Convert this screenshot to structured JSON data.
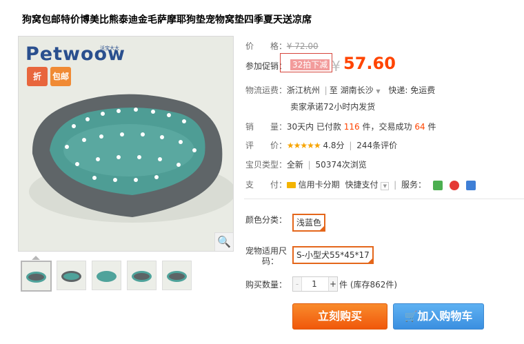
{
  "product": {
    "title": "狗窝包邮特价博美比熊泰迪金毛萨摩耶狗垫宠物窝垫四季夏天送凉席"
  },
  "gallery": {
    "logo_text": "Petwoow",
    "logo_sub": "沃宝大大",
    "badge1": "折",
    "badge2": "包邮",
    "thumb_count": 5
  },
  "price": {
    "label": "价　　格：",
    "yen": "¥",
    "original": "72.00"
  },
  "promo": {
    "label": "参加促销：",
    "tag": "32拍下减",
    "yen": "¥",
    "price": "57.60"
  },
  "shipping": {
    "label": "物流运费：",
    "from": "浙江杭州",
    "to_prefix": "至",
    "to": "湖南长沙",
    "fee_label": "快递:",
    "fee": "免运费",
    "promise": "卖家承诺72小时内发货"
  },
  "sales": {
    "label": "销　　量：",
    "prefix": "30天内 已付款",
    "paid": "116",
    "unit": "件，交易成功",
    "success": "64",
    "unit2": "件"
  },
  "rating": {
    "label": "评　　价：",
    "stars": "★★★★★",
    "score": "4.8分",
    "reviews": "244条评价"
  },
  "type": {
    "label": "宝贝类型：",
    "value": "全新",
    "views": "50374次浏览"
  },
  "payment": {
    "label": "支　　付：",
    "credit": "信用卡分期",
    "express": "快捷支付",
    "service_label": "服务："
  },
  "options": {
    "color_label": "颜色分类：",
    "color_value": "浅蓝色",
    "size_label_1": "宠物适用尺",
    "size_label_2": "码：",
    "size_value": "S-小型犬55*45*17"
  },
  "quantity": {
    "label": "购买数量：",
    "minus": "-",
    "value": "1",
    "plus": "+",
    "suffix": "件 (库存862件)"
  },
  "buttons": {
    "buy": "立刻购买",
    "cart": "加入购物车"
  },
  "colors": {
    "accent": "#ff4400",
    "buy": "#f0580b",
    "cart": "#3b8fe0"
  }
}
